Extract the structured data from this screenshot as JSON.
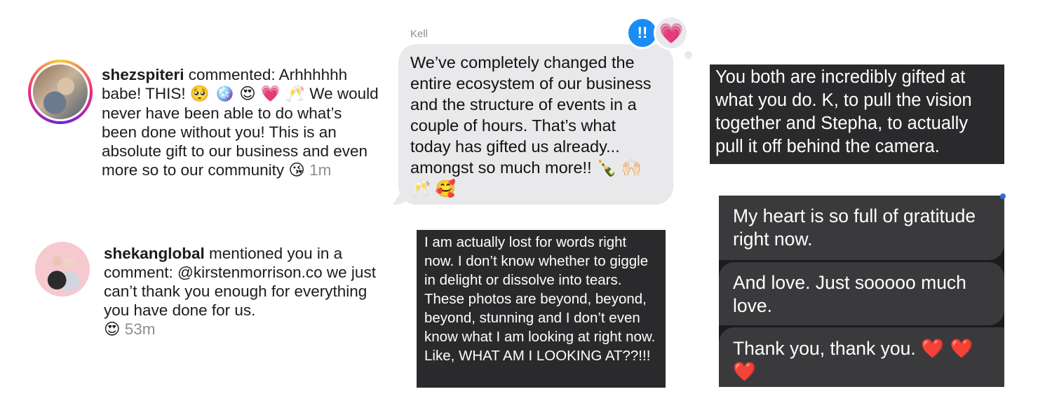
{
  "notifications": [
    {
      "username": "shezspiteri",
      "action": " commented: Arhhhhhh babe! THIS! ",
      "emojis_1": "🥺 🪩 😍 💗 🥂",
      "body": " We would never have been able to do what’s been done without you! This is an absolute gift to our business and even more so to our community ",
      "emoji_end": "😘",
      "time": "1m",
      "avatar": "story-ring-avatar"
    },
    {
      "username": "shekanglobal",
      "action": " mentioned you in a comment: @kirstenmorrison.co we just can’t thank you enough for everything you have done for us.",
      "emoji_end": "😍",
      "time": "53m",
      "avatar": "plain-avatar"
    }
  ],
  "imessage": {
    "sender": "Kell",
    "text": "We’ve completely changed the entire ecosystem of our business and the structure of events in a couple of hours. That’s what today has gifted us already... amongst so much more!! 🍾 🙌🏻 🥂 🥰",
    "tapback_exclaim": "!!",
    "tapback_heart": "💗"
  },
  "box_lost": {
    "text": "I am actually lost for words right now. I don’t know whether to giggle in delight or dissolve into tears. These photos are beyond, beyond, beyond, stunning and I don’t even know what I am looking at right now. Like, WHAT AM I LOOKING AT??!!!"
  },
  "box_gifted": {
    "text": "You both are incredibly gifted at what you do. K, to pull the vision together and Stepha, to actually pull it off behind the camera."
  },
  "dark_chat": {
    "msg_1": "My heart is so full of gratitude right now.",
    "msg_2": "And love. Just sooooo much love.",
    "msg_3": "Thank you, thank you. ",
    "msg_3_hearts": "❤️ ❤️ ❤️"
  },
  "colors": {
    "imessage_gray": "#e9e9eb",
    "tapback_blue": "#1b8cf5",
    "dark_box": "#2a2a2c",
    "dark_bubble": "#3a3a3c",
    "heart_red": "#e5252a"
  }
}
